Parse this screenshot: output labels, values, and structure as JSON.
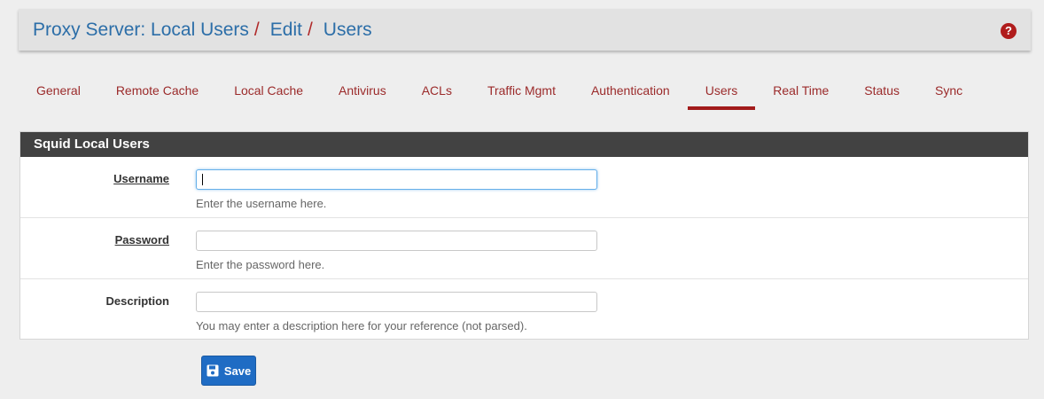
{
  "breadcrumb": {
    "items": [
      "Proxy Server: Local Users",
      "Edit",
      "Users"
    ],
    "separator": "/",
    "help_icon": "question-circle-icon"
  },
  "tabs": [
    {
      "label": "General",
      "active": false
    },
    {
      "label": "Remote Cache",
      "active": false
    },
    {
      "label": "Local Cache",
      "active": false
    },
    {
      "label": "Antivirus",
      "active": false
    },
    {
      "label": "ACLs",
      "active": false
    },
    {
      "label": "Traffic Mgmt",
      "active": false
    },
    {
      "label": "Authentication",
      "active": false
    },
    {
      "label": "Users",
      "active": true
    },
    {
      "label": "Real Time",
      "active": false
    },
    {
      "label": "Status",
      "active": false
    },
    {
      "label": "Sync",
      "active": false
    }
  ],
  "panel": {
    "title": "Squid Local Users",
    "fields": [
      {
        "label": "Username",
        "value": "",
        "help": "Enter the username here."
      },
      {
        "label": "Password",
        "value": "",
        "help": "Enter the password here."
      },
      {
        "label": "Description",
        "value": "",
        "help": "You may enter a description here for your reference (not parsed)."
      }
    ]
  },
  "save_button": {
    "label": "Save",
    "icon": "floppy-disk-icon"
  },
  "colors": {
    "accent": "#a21b1b",
    "link": "#2c6ea8",
    "button": "#1f6cc4",
    "heading_bg": "#424242"
  }
}
